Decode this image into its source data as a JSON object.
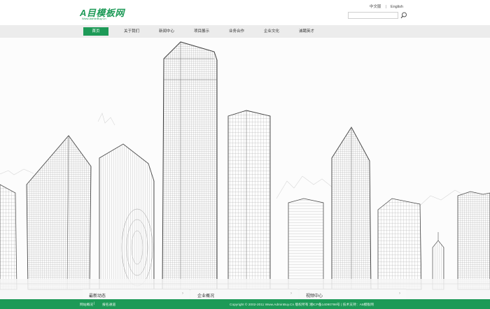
{
  "logo": {
    "name": "A目模板网",
    "tagline": "Www.AdminBuy.Cn"
  },
  "lang": {
    "chinese": "中文版",
    "english": "English"
  },
  "search": {
    "placeholder": ""
  },
  "nav": {
    "items": [
      {
        "label": "首页",
        "active": true
      },
      {
        "label": "关于我们",
        "active": false
      },
      {
        "label": "新闻中心",
        "active": false
      },
      {
        "label": "项目展示",
        "active": false
      },
      {
        "label": "业务合作",
        "active": false
      },
      {
        "label": "企业文化",
        "active": false
      },
      {
        "label": "诚聘英才",
        "active": false
      }
    ]
  },
  "quick_tabs": [
    {
      "label": "最新动态",
      "arrow": "›"
    },
    {
      "label": "企业概况",
      "arrow": "›"
    },
    {
      "label": "视频中心",
      "arrow": "›"
    }
  ],
  "footer": {
    "links": [
      "网站概况",
      "报名通道"
    ],
    "copyright": "Copyright © 2002-2011 Www.AdminBuy.Cn 版权所有  湘ICP备14090798号  |  技术支持：A5模板网"
  },
  "colors": {
    "brand": "#1d9a57",
    "nav_bg": "#ececec",
    "footer_bg": "#1d9a57"
  }
}
